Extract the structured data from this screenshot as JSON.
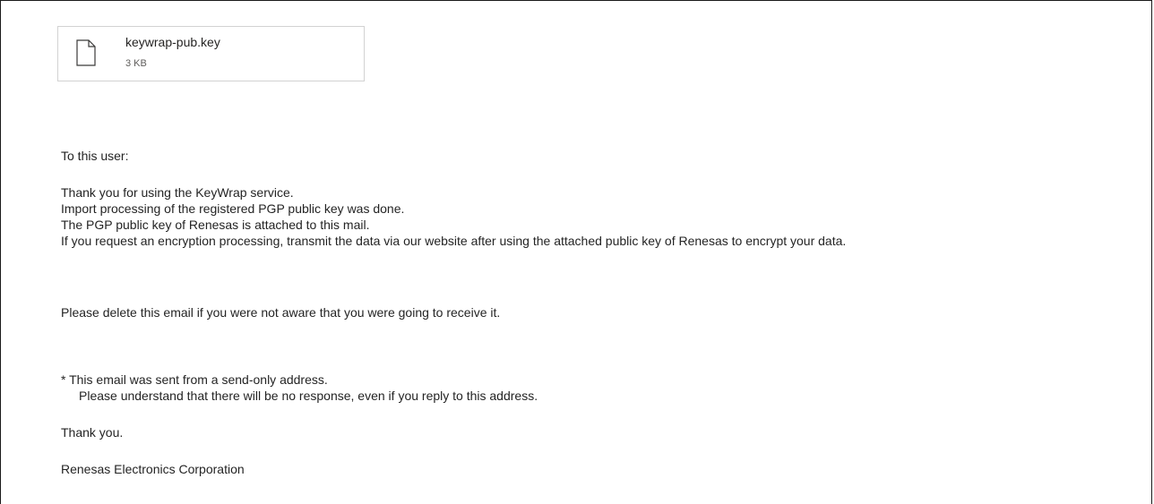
{
  "attachment": {
    "file_name": "keywrap-pub.key",
    "file_size": "3 KB",
    "icon": "file-icon"
  },
  "message": {
    "greeting": "To this user:",
    "para1": [
      "Thank you for using the KeyWrap service.",
      "Import processing of the registered PGP public key was done.",
      "The PGP public key of Renesas is attached to this mail.",
      "If you request an encryption processing, transmit the data via our website after using the attached public key of Renesas to encrypt your data."
    ],
    "para2": "Please delete this email if you were not aware that you were going to receive it.",
    "note": [
      "* This email was sent from a send-only address.",
      "Please understand that there will be no response, even if you reply to this address."
    ],
    "closing": "Thank you.",
    "signature": "Renesas Electronics Corporation"
  }
}
